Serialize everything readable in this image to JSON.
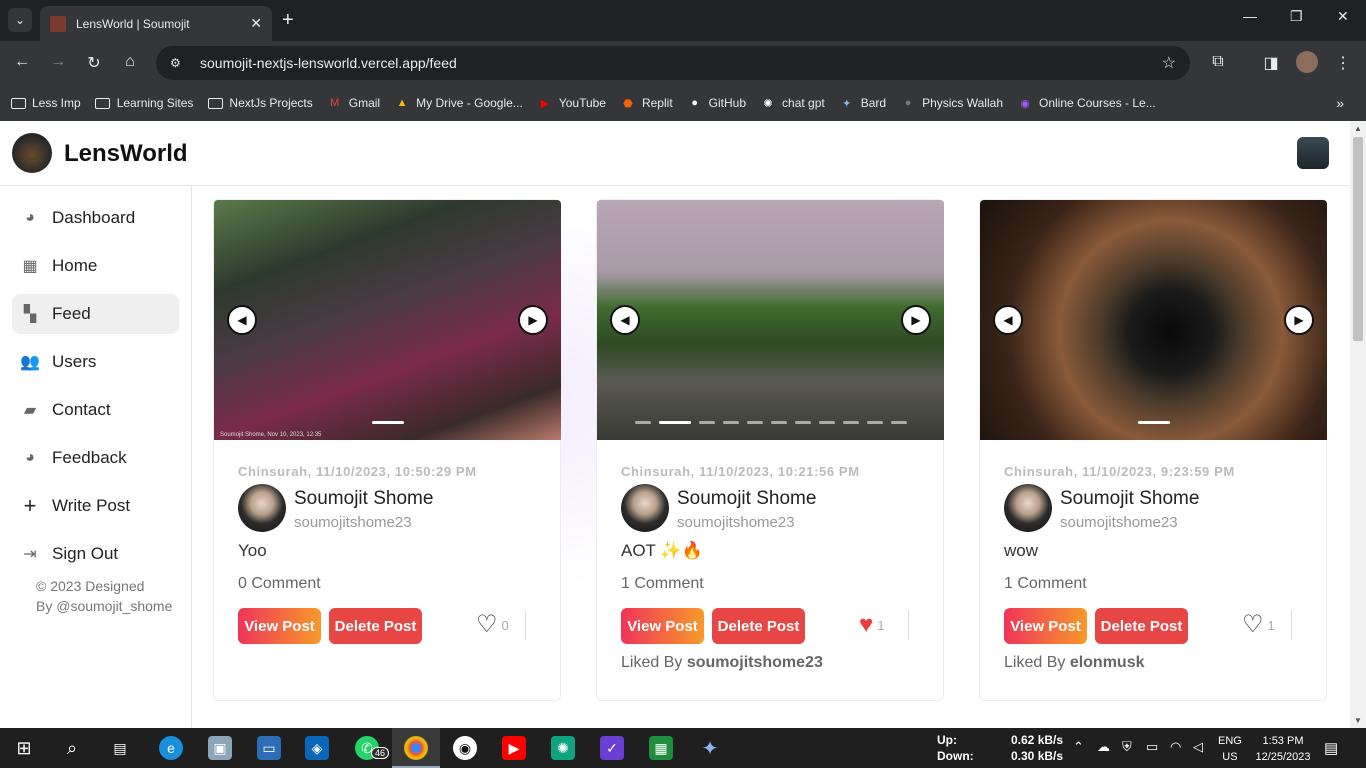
{
  "browser": {
    "tab_title": "LensWorld | Soumojit",
    "url": "soumojit-nextjs-lensworld.vercel.app/feed",
    "bookmarks": [
      {
        "label": "Less Imp",
        "icon": "folder-icon"
      },
      {
        "label": "Learning Sites",
        "icon": "folder-icon"
      },
      {
        "label": "NextJs Projects",
        "icon": "folder-icon"
      },
      {
        "label": "Gmail",
        "icon": "gmail-icon"
      },
      {
        "label": "My Drive - Google...",
        "icon": "drive-icon"
      },
      {
        "label": "YouTube",
        "icon": "youtube-icon"
      },
      {
        "label": "Replit",
        "icon": "replit-icon"
      },
      {
        "label": "GitHub",
        "icon": "github-icon"
      },
      {
        "label": "chat gpt",
        "icon": "chatgpt-icon"
      },
      {
        "label": "Bard",
        "icon": "bard-icon"
      },
      {
        "label": "Physics Wallah",
        "icon": "pw-icon"
      },
      {
        "label": "Online Courses - Le...",
        "icon": "courses-icon"
      }
    ]
  },
  "app": {
    "brand": "LensWorld"
  },
  "sidebar": {
    "items": [
      {
        "label": "Dashboard",
        "icon": "pie-chart-icon"
      },
      {
        "label": "Home",
        "icon": "grid-icon"
      },
      {
        "label": "Feed",
        "icon": "feed-icon"
      },
      {
        "label": "Users",
        "icon": "users-icon"
      },
      {
        "label": "Contact",
        "icon": "bag-icon"
      },
      {
        "label": "Feedback",
        "icon": "pie-chart-icon"
      },
      {
        "label": "Write Post",
        "icon": "plus-icon"
      },
      {
        "label": "Sign Out",
        "icon": "sign-out-icon"
      }
    ],
    "copyright_line1": "© 2023 Designed",
    "copyright_line2": "By @soumojit_shome"
  },
  "posts": [
    {
      "meta": "Chinsurah, 11/10/2023, 10:50:29 PM",
      "author_name": "Soumojit Shome",
      "author_user": "soumojitshome23",
      "caption": "Yoo",
      "comments": "0 Comment",
      "view_label": "View Post",
      "delete_label": "Delete Post",
      "likes": "0",
      "liked": false,
      "liked_by_prefix": "",
      "liked_by_user": "",
      "photo_caption": "Soumojit Shome, Nov 10, 2023, 12:35"
    },
    {
      "meta": "Chinsurah, 11/10/2023, 10:21:56 PM",
      "author_name": "Soumojit Shome",
      "author_user": "soumojitshome23",
      "caption": "AOT ✨🔥",
      "comments": "1 Comment",
      "view_label": "View Post",
      "delete_label": "Delete Post",
      "likes": "1",
      "liked": true,
      "liked_by_prefix": "Liked By ",
      "liked_by_user": "soumojitshome23"
    },
    {
      "meta": "Chinsurah, 11/10/2023, 9:23:59 PM",
      "author_name": "Soumojit Shome",
      "author_user": "soumojitshome23",
      "caption": "wow",
      "comments": "1 Comment",
      "view_label": "View Post",
      "delete_label": "Delete Post",
      "likes": "1",
      "liked": false,
      "liked_by_prefix": "Liked By ",
      "liked_by_user": "elonmusk"
    }
  ],
  "taskbar": {
    "whatsapp_badge": "46",
    "net_up_label": "Up:",
    "net_down_label": "Down:",
    "net_up": "0.62 kB/s",
    "net_down": "0.30 kB/s",
    "lang1": "ENG",
    "lang2": "US",
    "time": "1:53 PM",
    "date": "12/25/2023"
  }
}
